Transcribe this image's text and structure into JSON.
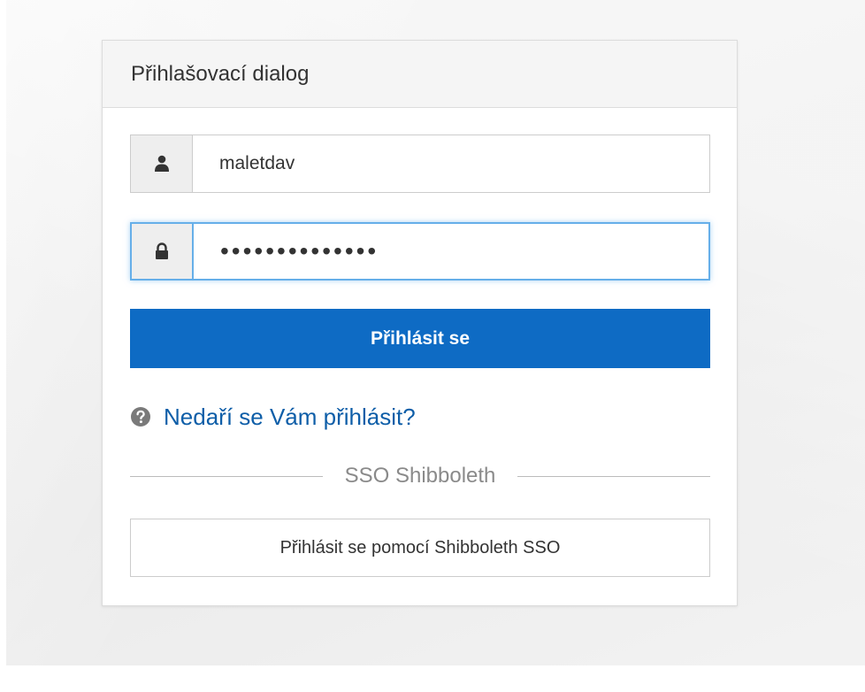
{
  "dialog": {
    "title": "Přihlašovací dialog"
  },
  "form": {
    "username": {
      "value": "maletdav",
      "icon": "user-icon"
    },
    "password": {
      "value": "••••••••••••••",
      "icon": "lock-icon"
    },
    "login_label": "Přihlásit se"
  },
  "help": {
    "icon": "question-circle-icon",
    "link_text": "Nedaří se Vám přihlásit?"
  },
  "sso": {
    "divider_label": "SSO Shibboleth",
    "button_label": "Přihlásit se pomocí Shibboleth SSO"
  },
  "colors": {
    "primary": "#0e6bc4",
    "link": "#0e5ea8",
    "focus": "#66afe9"
  }
}
